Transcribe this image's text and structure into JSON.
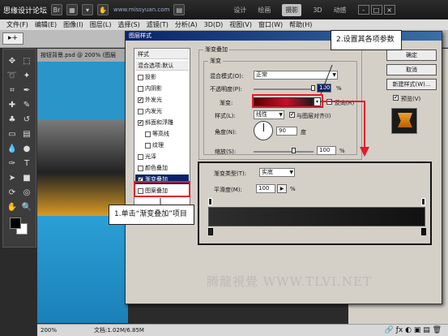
{
  "titlebar": {
    "brand": "思缘设计论坛",
    "watermark_url": "www.missyuan.com",
    "workspace_tabs": [
      "设计",
      "绘画",
      "摄影",
      "3D",
      "动感"
    ],
    "active_tab": "摄影",
    "window_controls": [
      "-",
      "□",
      "×"
    ]
  },
  "menubar": [
    "文件(F)",
    "编辑(E)",
    "图像(I)",
    "图层(L)",
    "选择(S)",
    "滤镜(T)",
    "分析(A)",
    "3D(D)",
    "视图(V)",
    "窗口(W)",
    "帮助(H)"
  ],
  "document": {
    "tab": "按钮背景.psd @ 200% (图层",
    "zoom": "200%",
    "doc_info": "文档:1.02M/6.85M"
  },
  "dialog": {
    "title": "图层样式",
    "styles_header": "样式",
    "blend_options": "混合选项:默认",
    "styles": [
      {
        "label": "投影",
        "checked": false,
        "sub": false
      },
      {
        "label": "内阴影",
        "checked": false,
        "sub": false
      },
      {
        "label": "外发光",
        "checked": true,
        "sub": false
      },
      {
        "label": "内发光",
        "checked": false,
        "sub": false
      },
      {
        "label": "斜面和浮雕",
        "checked": true,
        "sub": false
      },
      {
        "label": "等高线",
        "checked": false,
        "sub": true
      },
      {
        "label": "纹理",
        "checked": false,
        "sub": true
      },
      {
        "label": "光泽",
        "checked": false,
        "sub": false
      },
      {
        "label": "颜色叠加",
        "checked": false,
        "sub": false
      },
      {
        "label": "渐变叠加",
        "checked": true,
        "sub": false,
        "selected": true
      },
      {
        "label": "图案叠加",
        "checked": false,
        "sub": false
      }
    ],
    "panel": {
      "group_title": "渐变叠加",
      "subgroup_title": "渐变",
      "blend_mode_label": "混合模式(O):",
      "blend_mode": "正常",
      "opacity_label": "不透明度(P):",
      "opacity": "100",
      "opacity_unit": "%",
      "opacity_level": 1.0,
      "gradient_label": "渐变:",
      "reverse_label": "反向(R)",
      "style_label": "样式(L):",
      "style": "线性",
      "align_label": "与图层对齐(I)",
      "angle_label": "角度(N):",
      "angle": "90",
      "angle_unit": "度",
      "scale_label": "缩放(S):",
      "scale": "100",
      "scale_unit": "%",
      "scale_level": 0.67
    },
    "buttons": [
      "确定",
      "取消",
      "新建样式(W)..."
    ],
    "preview_label": "预览(V)"
  },
  "gradient_editor": {
    "type_label": "渐变类型(T):",
    "type": "实底",
    "smooth_label": "平滑度(M):",
    "smooth": "100",
    "smooth_unit": "%"
  },
  "callouts": {
    "step1": "1.单击“渐变叠加”项目",
    "step2": "2.设置其各项参数"
  },
  "watermark": "腾龍視覺 WWW.TLVI.NET",
  "colors": {
    "accent": "#0a246a",
    "callout_red": "#e8192c",
    "canvas_blue": "#2a95c8",
    "gradient_dark": "#1a1a1a"
  }
}
